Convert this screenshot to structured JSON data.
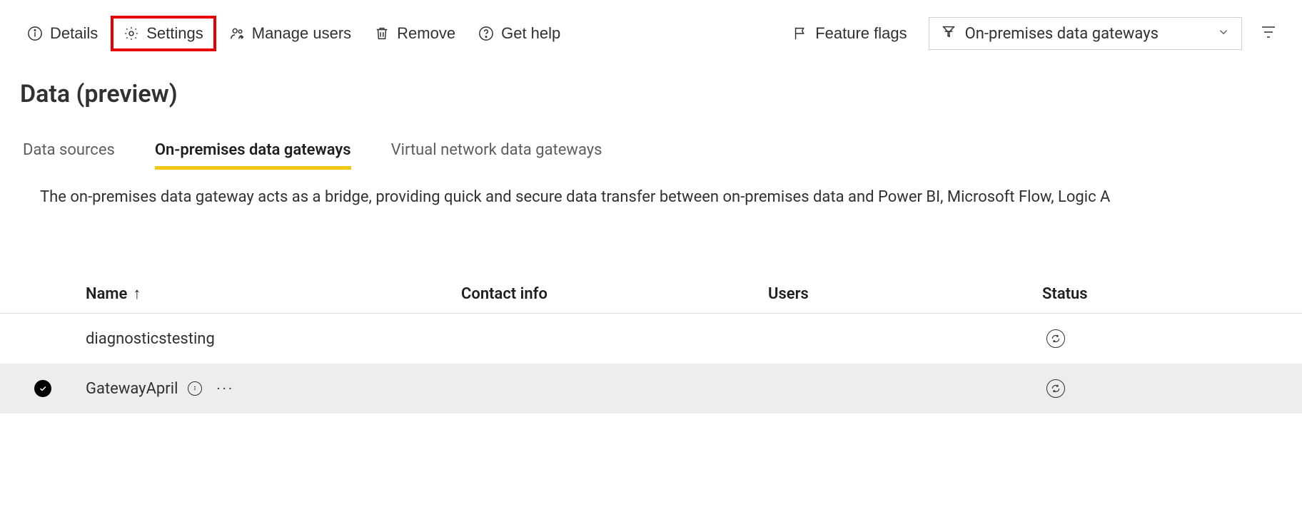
{
  "toolbar": {
    "details": "Details",
    "settings": "Settings",
    "manage_users": "Manage users",
    "remove": "Remove",
    "get_help": "Get help",
    "feature_flags": "Feature flags",
    "filter_selected": "On-premises data gateways"
  },
  "page": {
    "heading": "Data (preview)"
  },
  "tabs": {
    "data_sources": "Data sources",
    "on_prem": "On-premises data gateways",
    "virtual": "Virtual network data gateways"
  },
  "description": "The on-premises data gateway acts as a bridge, providing quick and secure data transfer between on-premises data and Power BI, Microsoft Flow, Logic A",
  "table": {
    "columns": {
      "name": "Name",
      "sort_arrow": "↑",
      "contact": "Contact info",
      "users": "Users",
      "status": "Status"
    },
    "rows": [
      {
        "name": "diagnosticstesting",
        "contact": "",
        "users": "",
        "selected": false,
        "has_info": false
      },
      {
        "name": "GatewayApril",
        "contact": "",
        "users": "",
        "selected": true,
        "has_info": true
      }
    ]
  }
}
